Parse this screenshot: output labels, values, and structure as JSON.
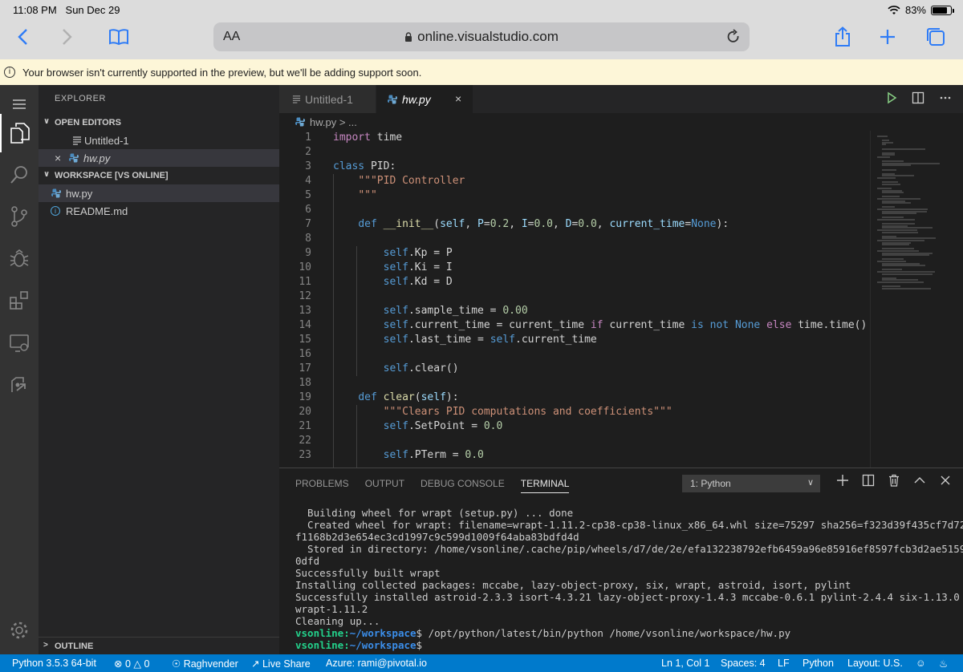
{
  "ios": {
    "time": "11:08 PM",
    "date": "Sun Dec 29",
    "battery": "83%",
    "battery_level": 0.83
  },
  "safari": {
    "text_size_label": "AA",
    "url": "online.visualstudio.com"
  },
  "banner": {
    "message": "Your browser isn't currently supported in the preview, but we'll be adding support soon."
  },
  "sidebar": {
    "title": "EXPLORER",
    "open_editors_label": "OPEN EDITORS",
    "open_editors": [
      {
        "label": "Untitled-1"
      },
      {
        "label": "hw.py"
      }
    ],
    "workspace_label": "WORKSPACE [VS ONLINE]",
    "files": [
      {
        "label": "hw.py"
      },
      {
        "label": "README.md"
      }
    ],
    "outline_label": "OUTLINE"
  },
  "tabs": [
    {
      "label": "Untitled-1"
    },
    {
      "label": "hw.py"
    }
  ],
  "breadcrumb": {
    "label": "hw.py > ..."
  },
  "editor": {
    "line_numbers": [
      "1",
      "2",
      "3",
      "4",
      "5",
      "6",
      "7",
      "8",
      "9",
      "10",
      "11",
      "12",
      "13",
      "14",
      "15",
      "16",
      "17",
      "18",
      "19",
      "20",
      "21",
      "22",
      "23"
    ]
  },
  "panel": {
    "tabs": [
      "PROBLEMS",
      "OUTPUT",
      "DEBUG CONSOLE",
      "TERMINAL"
    ],
    "active_tab": "TERMINAL",
    "terminal_select": "1: Python",
    "terminal_lines": [
      "  Building wheel for wrapt (setup.py) ... done",
      "  Created wheel for wrapt: filename=wrapt-1.11.2-cp38-cp38-linux_x86_64.whl size=75297 sha256=f323d39f435cf7d72",
      "f1168b2d3e654ec3cd1997c9c599d1009f64aba83bdfd4d",
      "  Stored in directory: /home/vsonline/.cache/pip/wheels/d7/de/2e/efa132238792efb6459a96e85916ef8597fcb3d2ae5159",
      "0dfd",
      "Successfully built wrapt",
      "Installing collected packages: mccabe, lazy-object-proxy, six, wrapt, astroid, isort, pylint",
      "Successfully installed astroid-2.3.3 isort-4.3.21 lazy-object-proxy-1.4.3 mccabe-0.6.1 pylint-2.4.4 six-1.13.0",
      "wrapt-1.11.2",
      "Cleaning up..."
    ],
    "prompt_user": "vsonline",
    "prompt_path": "~/workspace",
    "prompt_command": "$ /opt/python/latest/bin/python /home/vsonline/workspace/hw.py",
    "prompt_empty": "$"
  },
  "statusbar": {
    "python": "Python 3.5.3 64-bit",
    "errors": "0",
    "warnings": "0",
    "user": "Raghvender",
    "live_share": "Live Share",
    "azure": "Azure: rami@pivotal.io",
    "position": "Ln 1, Col 1",
    "spaces": "Spaces: 4",
    "eol": "LF",
    "language": "Python",
    "layout": "Layout: U.S."
  }
}
